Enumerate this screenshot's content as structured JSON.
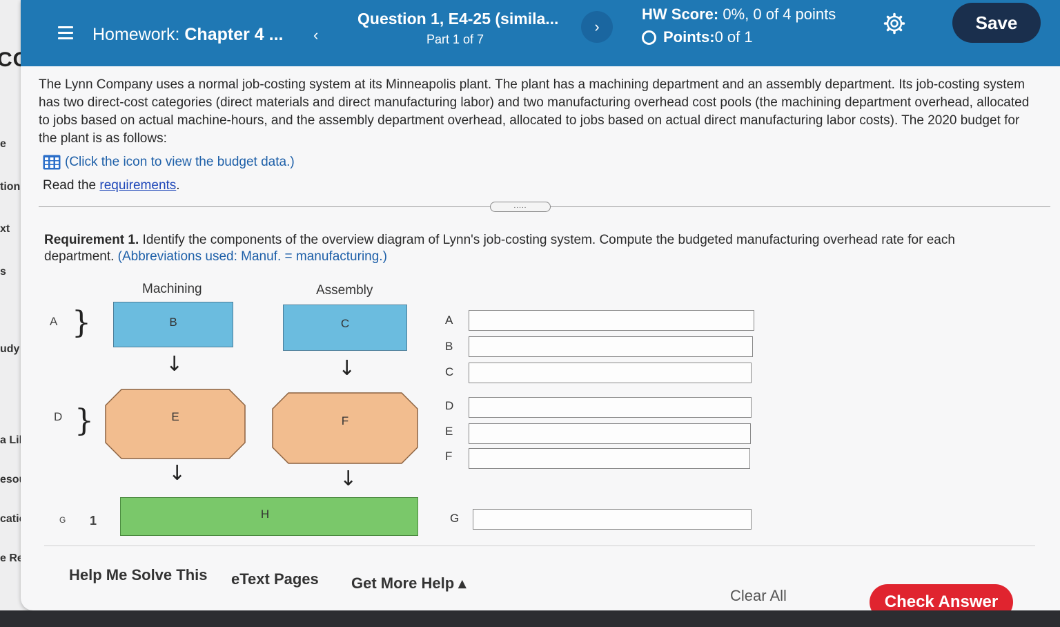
{
  "sidebar": {
    "logo": "COU",
    "items": [
      "e",
      "tions",
      "xt",
      "s",
      "udy",
      "a Libra",
      "esource",
      "cation T",
      "e Resou"
    ]
  },
  "header": {
    "hw_prefix": "Homework: ",
    "hw_chapter": "Chapter 4 ...",
    "question_title": "Question 1, E4-25 (simila...",
    "question_part": "Part 1 of 7",
    "hw_score_label": "HW Score:",
    "hw_score_value": " 0%, 0 of 4 points",
    "points_label": "Points:",
    "points_value": " 0 of 1",
    "save_label": "Save",
    "next_icon": "chevron-right-icon",
    "accent_color": "#1f78b4"
  },
  "problem": {
    "text": "The Lynn Company uses a normal job-costing system at its Minneapolis plant. The plant has a machining department and an assembly department. Its job-costing system has two direct-cost categories (direct materials and direct manufacturing labor) and two manufacturing overhead cost pools (the machining department overhead, allocated to jobs based on actual machine-hours, and the assembly department overhead, allocated to jobs based on actual direct manufacturing labor costs). The 2020 budget for the plant is as follows:",
    "budget_link": "(Click the icon to view the budget data.)",
    "read_prefix": "Read the ",
    "requirements_link": "requirements",
    "read_suffix": "."
  },
  "divider_handle": ".....",
  "requirement": {
    "label": "Requirement 1.",
    "text": " Identify the components of the overview diagram of Lynn's job-costing system. Compute the budgeted manufacturing overhead rate for each department. ",
    "abbrev": "(Abbreviations used: Manuf. = manufacturing.)"
  },
  "diagram": {
    "col_machining": "Machining",
    "col_assembly": "Assembly",
    "brace_a": "A",
    "brace_d": "D",
    "brace_g": "G",
    "box_b": "B",
    "box_c": "C",
    "box_e": "E",
    "box_f": "F",
    "box_h": "H",
    "arrow": "↓",
    "brace": "}",
    "brace_g_symbol": "1"
  },
  "answers": [
    {
      "letter": "A",
      "value": ""
    },
    {
      "letter": "B",
      "value": ""
    },
    {
      "letter": "C",
      "value": ""
    },
    {
      "letter": "D",
      "value": ""
    },
    {
      "letter": "E",
      "value": ""
    },
    {
      "letter": "F",
      "value": ""
    },
    {
      "letter": "G",
      "value": ""
    }
  ],
  "footer": {
    "help_me": "Help Me Solve This",
    "etext": "eText Pages",
    "more_help": "Get More Help ▴",
    "clear_all": "Clear All",
    "check_answer": "Check Answer",
    "check_color": "#e0242f"
  }
}
